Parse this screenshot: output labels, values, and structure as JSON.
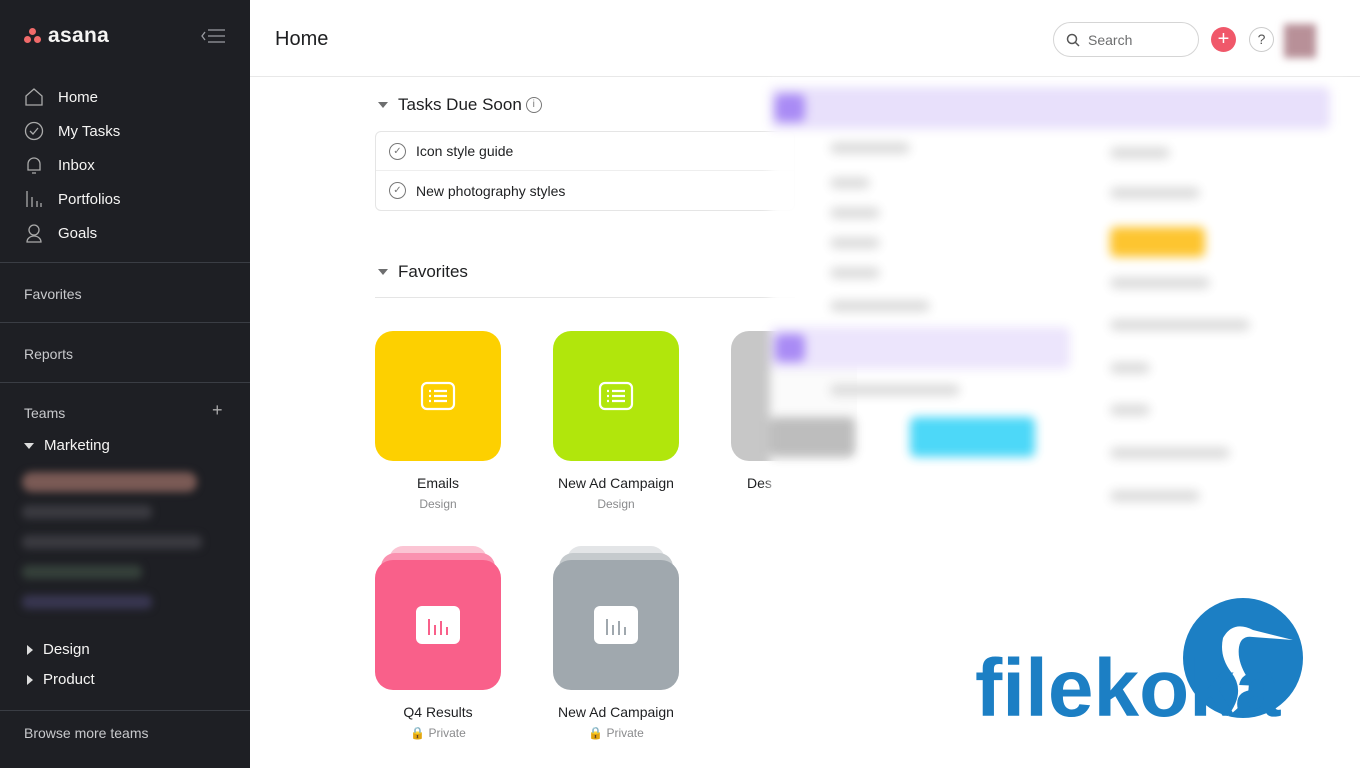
{
  "sidebar": {
    "brand": "asana",
    "nav": [
      {
        "label": "Home",
        "icon": "home-icon"
      },
      {
        "label": "My Tasks",
        "icon": "check-circle-icon"
      },
      {
        "label": "Inbox",
        "icon": "bell-icon"
      },
      {
        "label": "Portfolios",
        "icon": "bar-chart-icon"
      },
      {
        "label": "Goals",
        "icon": "person-icon"
      }
    ],
    "favorites": "Favorites",
    "reports": "Reports",
    "teams": "Teams",
    "team_expanded": "Marketing",
    "teams_collapsed": [
      "Design",
      "Product"
    ],
    "browse": "Browse more teams"
  },
  "header": {
    "title": "Home",
    "search_placeholder": "Search",
    "help": "?",
    "plus": "+"
  },
  "tasks_due": {
    "title": "Tasks Due Soon",
    "items": [
      "Icon style guide",
      "New photography styles"
    ]
  },
  "favorites": {
    "title": "Favorites",
    "tiles": [
      {
        "name": "Emails",
        "sub": "Design",
        "color": "#fdd000"
      },
      {
        "name": "New Ad Campaign",
        "sub": "Design",
        "color": "#b1e60c"
      },
      {
        "name": "Des",
        "sub": "",
        "color": "#c7c7c7"
      },
      {
        "name": "Q4 Results",
        "sub": "Private",
        "color": "#f9608a"
      },
      {
        "name": "New Ad Campaign",
        "sub": "Private",
        "color": "#a0a8ae"
      }
    ]
  },
  "watermark": "filekoka"
}
